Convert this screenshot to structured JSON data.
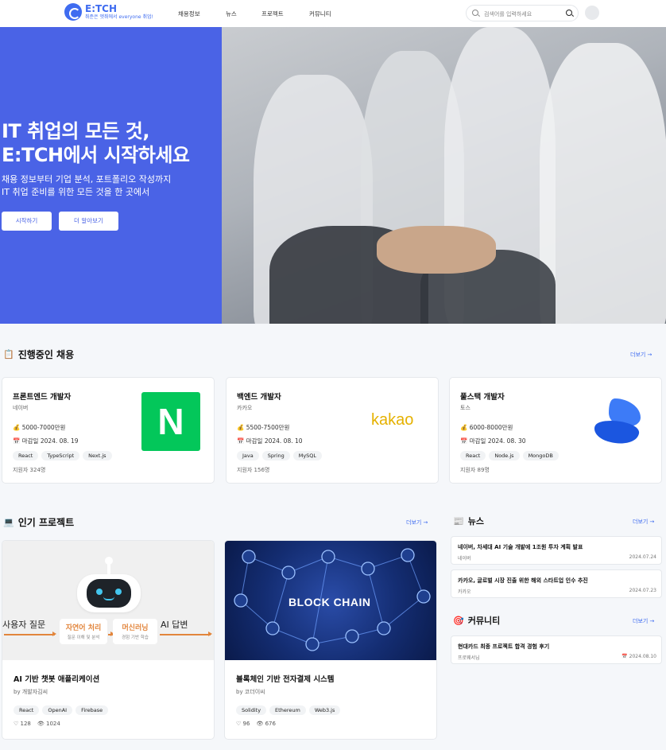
{
  "header": {
    "logo_name": "E:TCH",
    "logo_tagline": "취준은 엣취에서 everyone 취업!",
    "nav": [
      "채용정보",
      "뉴스",
      "프로젝트",
      "커뮤니티"
    ],
    "search_placeholder": "검색어를 입력하세요"
  },
  "hero": {
    "title_line1": "IT 취업의 모든 것,",
    "title_line2": "E:TCH에서 시작하세요",
    "sub_line1": "채용 정보부터 기업 분석, 포트폴리오 작성까지",
    "sub_line2": "IT 취업 준비를 위한 모든 것을 한 곳에서",
    "btn_start": "시작하기",
    "btn_more": "더 알아보기"
  },
  "jobs_section": {
    "icon": "clipboard-icon",
    "title": "진행중인 채용",
    "more": "더보기 →",
    "cards": [
      {
        "title": "프론트엔드 개발자",
        "company": "네이버",
        "salary": "5000-7000만원",
        "deadline": "마감일 2024. 08. 19",
        "tags": [
          "React",
          "TypeScript",
          "Next.js"
        ],
        "applicants": "지원자 324명",
        "logo": "naver-logo",
        "logo_text": "N"
      },
      {
        "title": "백엔드 개발자",
        "company": "카카오",
        "salary": "5500-7500만원",
        "deadline": "마감일 2024. 08. 10",
        "tags": [
          "Java",
          "Spring",
          "MySQL"
        ],
        "applicants": "지원자 156명",
        "logo": "kakao-logo",
        "logo_text": "kakao"
      },
      {
        "title": "풀스택 개발자",
        "company": "토스",
        "salary": "6000-8000만원",
        "deadline": "마감일 2024. 08. 30",
        "tags": [
          "React",
          "Node.js",
          "MongoDB"
        ],
        "applicants": "지원자 89명",
        "logo": "toss-logo"
      }
    ]
  },
  "projects_section": {
    "icon": "laptop-icon",
    "title": "인기 프로젝트",
    "more": "더보기 →",
    "cards": [
      {
        "title": "AI 기반 챗봇 애플리케이션",
        "author": "by 개발자김씨",
        "tags": [
          "React",
          "OpenAI",
          "Firebase"
        ],
        "likes": "128",
        "views": "1024",
        "image": {
          "left_text": "사용자 질문",
          "box1_title": "자연어 처리",
          "box1_sub": "질문 이해 및 분석",
          "box2_title": "머신러닝",
          "box2_sub": "경험 기반 학습",
          "right_text": "AI 답변"
        }
      },
      {
        "title": "블록체인 기반 전자결제 시스템",
        "author": "by 코더이씨",
        "tags": [
          "Solidity",
          "Ethereum",
          "Web3.js"
        ],
        "likes": "96",
        "views": "676",
        "image": {
          "text": "BLOCK CHAIN"
        }
      }
    ]
  },
  "news_section": {
    "icon": "newspaper-icon",
    "title": "뉴스",
    "more": "더보기 →",
    "items": [
      {
        "title": "네이버, 차세대 AI 기술 개발에 1조원 투자 계획 발표",
        "source": "네이버",
        "date": "2024.07.24"
      },
      {
        "title": "카카오, 글로벌 시장 진출 위한 해외 스타트업 인수 추진",
        "source": "카카오",
        "date": "2024.07.23"
      }
    ]
  },
  "community_section": {
    "icon": "target-icon",
    "title": "커뮤니티",
    "more": "더보기 →",
    "items": [
      {
        "title": "현대카드 최종 프로젝트 합격 경험 후기",
        "author": "프로웨서님",
        "date": "2024.08.10"
      }
    ]
  }
}
